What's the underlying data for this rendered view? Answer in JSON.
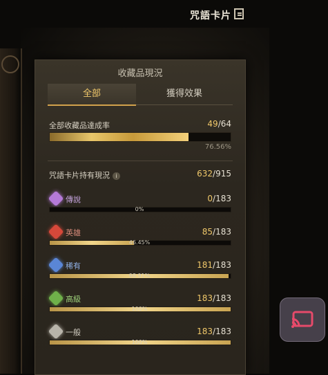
{
  "header": {
    "title": "咒語卡片",
    "icon": "exit-panel-icon"
  },
  "panel": {
    "title": "收藏品現況",
    "tabs": [
      {
        "label": "全部",
        "active": true
      },
      {
        "label": "獲得效果",
        "active": false
      }
    ],
    "overall": {
      "label": "全部收藏品達成率",
      "current": "49",
      "total": "/64",
      "progress": 0.7656,
      "percent_label": "76.56%"
    },
    "spell_status": {
      "label": "咒語卡片持有現況",
      "info_icon": "i",
      "current": "632",
      "total": "/915"
    },
    "rarities": [
      {
        "name": "傳說",
        "current": "0",
        "total": "/183",
        "progress": 0.0,
        "percent_label": "0%",
        "color": "#b57ad8",
        "name_color": "#c8a6e0",
        "icon": "legendary-rarity-icon"
      },
      {
        "name": "英雄",
        "current": "85",
        "total": "/183",
        "progress": 0.4645,
        "percent_label": "46.45%",
        "color": "#d6483a",
        "name_color": "#d88a7a",
        "icon": "hero-rarity-icon"
      },
      {
        "name": "稀有",
        "current": "181",
        "total": "/183",
        "progress": 0.9891,
        "percent_label": "98.91%",
        "color": "#5a86d6",
        "name_color": "#8fb0e6",
        "icon": "rare-rarity-icon"
      },
      {
        "name": "高級",
        "current": "183",
        "total": "/183",
        "progress": 1.0,
        "percent_label": "100%",
        "color": "#6fb04a",
        "name_color": "#9ed07a",
        "icon": "advanced-rarity-icon"
      },
      {
        "name": "一般",
        "current": "183",
        "total": "/183",
        "progress": 1.0,
        "percent_label": "100%",
        "color": "#b8b4aa",
        "name_color": "#d4d0c4",
        "icon": "common-rarity-icon"
      }
    ]
  },
  "cast_button": {
    "icon": "screen-cast-icon"
  }
}
